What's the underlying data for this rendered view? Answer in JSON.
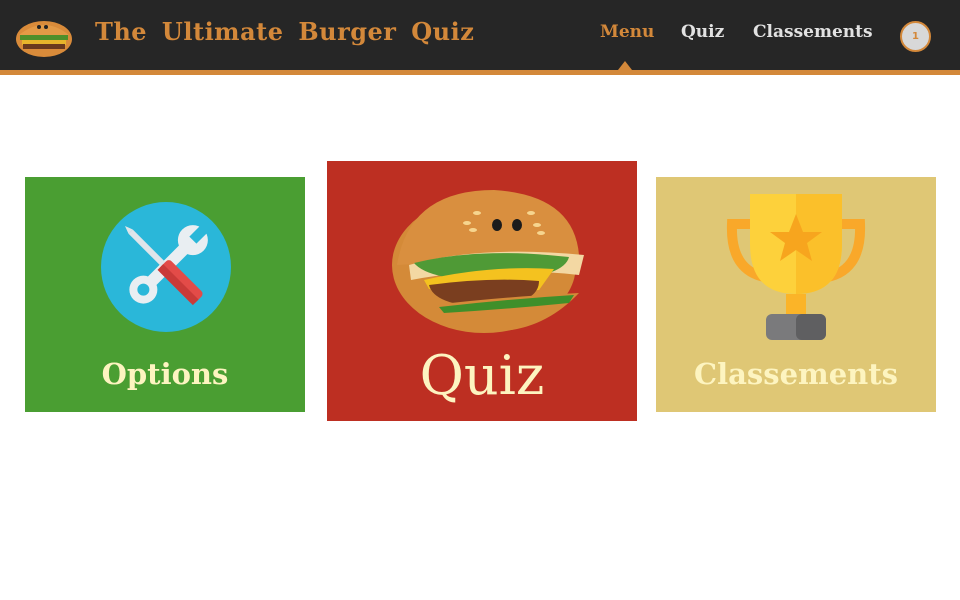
{
  "header": {
    "title": "The Ultimate Burger Quiz",
    "logo_icon": "burger-icon",
    "nav": [
      {
        "label": "Menu",
        "active": true
      },
      {
        "label": "Quiz",
        "active": false
      },
      {
        "label": "Classements",
        "active": false
      }
    ],
    "user_badge": "1"
  },
  "tiles": [
    {
      "label": "Options",
      "icon": "tools-icon",
      "color": "#4a9e32"
    },
    {
      "label": "Quiz",
      "icon": "burger-icon",
      "color": "#bd2f22"
    },
    {
      "label": "Classements",
      "icon": "trophy-icon",
      "color": "#dfc775"
    }
  ],
  "colors": {
    "accent": "#d3883a",
    "header_bg": "#262626",
    "tile_text": "#fdf4c0"
  }
}
